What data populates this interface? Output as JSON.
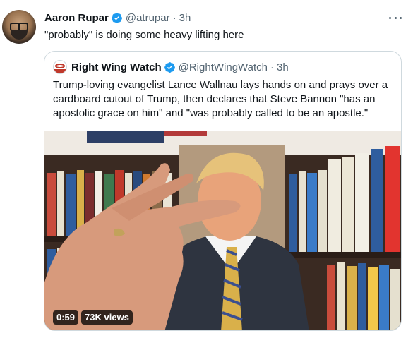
{
  "tweet": {
    "author_name": "Aaron Rupar",
    "author_handle": "@atrupar",
    "separator": "·",
    "time": "3h",
    "text": "\"probably\" is doing some heavy lifting here"
  },
  "quoted_tweet": {
    "author_name": "Right Wing Watch",
    "author_handle": "@RightWingWatch",
    "separator": "·",
    "time": "3h",
    "text_lines": [
      "Trump-loving evangelist Lance Wallnau lays hands on and prays over a",
      "cardboard cutout of Trump, then declares that Steve Bannon \"has an",
      "apostolic grace on him\" and \"was probably called to be an apostle.\""
    ],
    "video": {
      "duration": "0:59",
      "views": "73K views"
    }
  },
  "icons": {
    "verified": "verified-badge-icon",
    "more": "more-dots-icon"
  },
  "colors": {
    "verified_blue": "#1d9bf0",
    "text_primary": "#0f1419",
    "text_secondary": "#536471",
    "border": "#cfd9de"
  }
}
